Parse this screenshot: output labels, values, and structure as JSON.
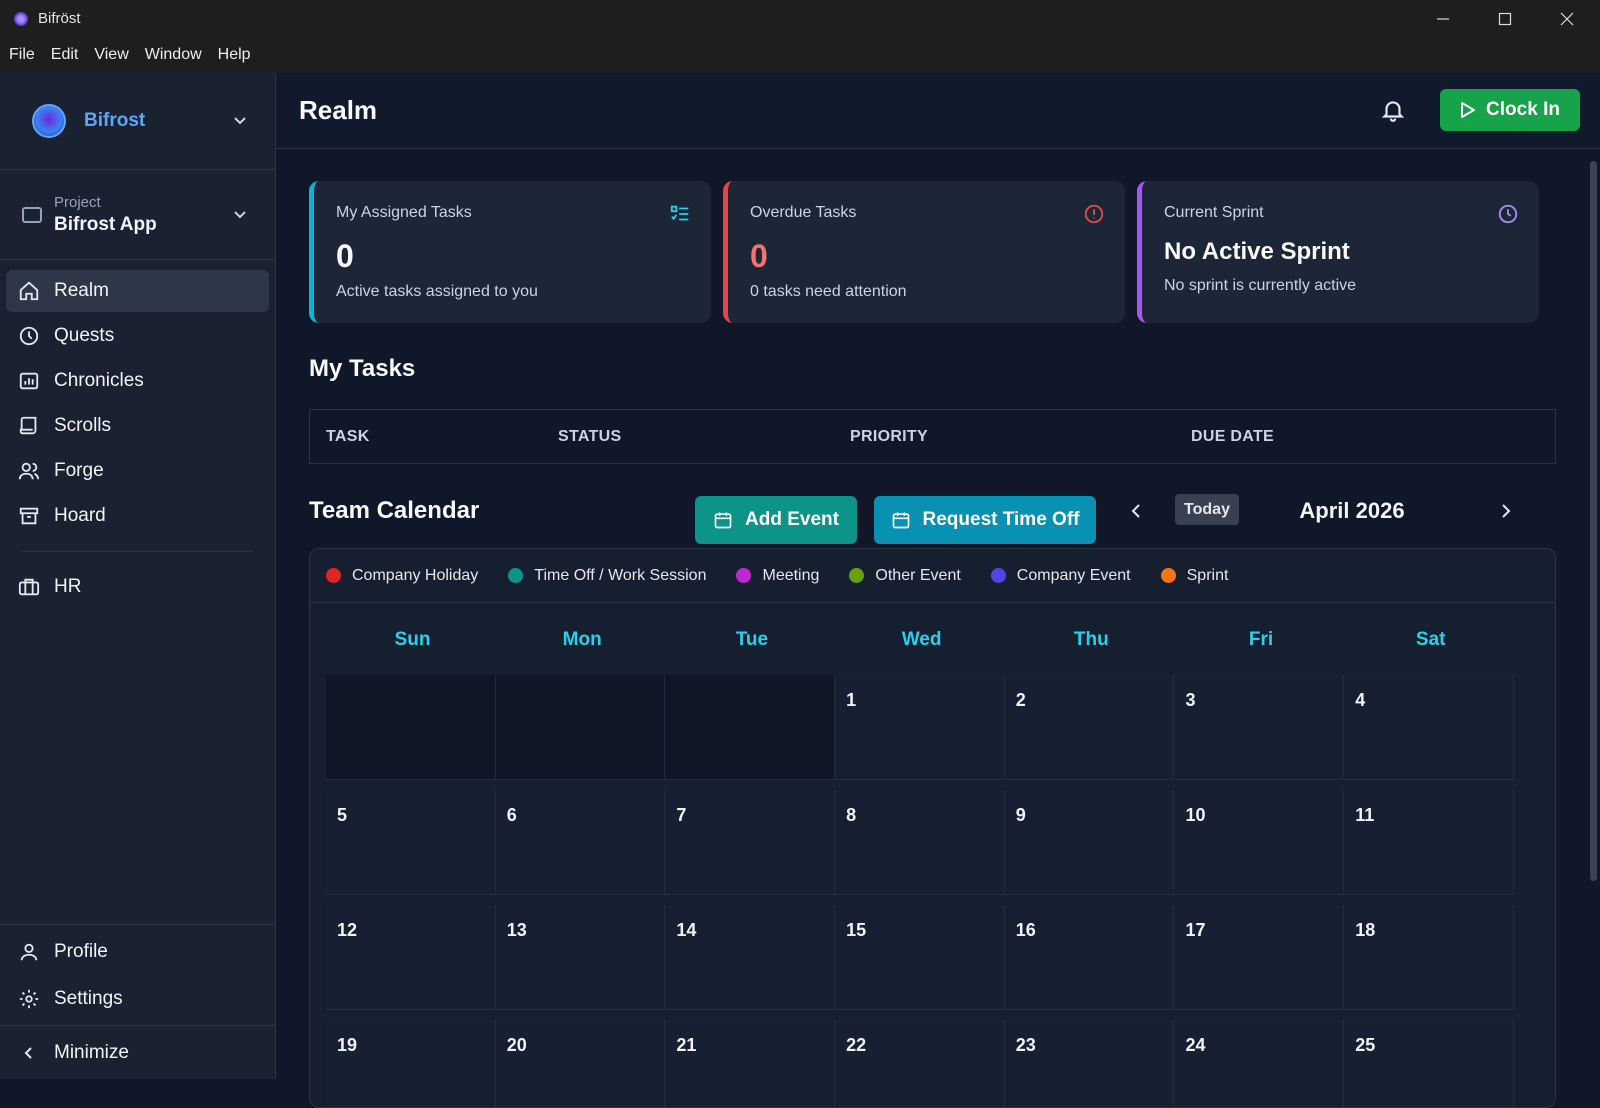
{
  "window": {
    "title": "Bifröst",
    "controls": [
      "minimize",
      "maximize",
      "close"
    ]
  },
  "menu": [
    "File",
    "Edit",
    "View",
    "Window",
    "Help"
  ],
  "sidebar": {
    "workspace": "Bifrost",
    "project": {
      "label": "Project",
      "name": "Bifrost App"
    },
    "items": [
      {
        "label": "Realm",
        "icon": "home-icon",
        "active": true
      },
      {
        "label": "Quests",
        "icon": "clock-icon"
      },
      {
        "label": "Chronicles",
        "icon": "chart-folder-icon"
      },
      {
        "label": "Scrolls",
        "icon": "scroll-icon"
      },
      {
        "label": "Forge",
        "icon": "users-icon"
      },
      {
        "label": "Hoard",
        "icon": "archive-icon"
      }
    ],
    "hr": {
      "label": "HR",
      "icon": "briefcase-icon"
    },
    "profile": "Profile",
    "settings": "Settings",
    "minimize": "Minimize"
  },
  "header": {
    "title": "Realm",
    "clock_in": "Clock In",
    "accent": "#16a34a"
  },
  "cards": [
    {
      "title": "My Assigned Tasks",
      "value": "0",
      "subtitle": "Active tasks assigned to you",
      "color": "#06b6d4",
      "icon": "checklist-icon"
    },
    {
      "title": "Overdue Tasks",
      "value": "0",
      "subtitle": "0 tasks need attention",
      "color": "#ef4444",
      "icon": "alert-icon"
    },
    {
      "title": "Current Sprint",
      "value": "No Active Sprint",
      "subtitle": "No sprint is currently active",
      "color": "#a855f7",
      "icon": "clock-icon"
    }
  ],
  "tasks": {
    "title": "My Tasks",
    "columns": [
      "TASK",
      "STATUS",
      "PRIORITY",
      "DUE DATE"
    ]
  },
  "calendar": {
    "title": "Team Calendar",
    "add_event": "Add Event",
    "request_time_off": "Request Time Off",
    "today": "Today",
    "month": "April 2026",
    "legend": [
      {
        "label": "Company Holiday",
        "color": "#dc2626"
      },
      {
        "label": "Time Off / Work Session",
        "color": "#0d9488"
      },
      {
        "label": "Meeting",
        "color": "#c026d3"
      },
      {
        "label": "Other Event",
        "color": "#65a30d"
      },
      {
        "label": "Company Event",
        "color": "#4f46e5"
      },
      {
        "label": "Sprint",
        "color": "#f97316"
      }
    ],
    "weekdays": [
      "Sun",
      "Mon",
      "Tue",
      "Wed",
      "Thu",
      "Fri",
      "Sat"
    ],
    "weeks": [
      [
        "",
        "",
        "",
        "1",
        "2",
        "3",
        "4"
      ],
      [
        "5",
        "6",
        "7",
        "8",
        "9",
        "10",
        "11"
      ],
      [
        "12",
        "13",
        "14",
        "15",
        "16",
        "17",
        "18"
      ],
      [
        "19",
        "20",
        "21",
        "22",
        "23",
        "24",
        "25"
      ]
    ]
  }
}
